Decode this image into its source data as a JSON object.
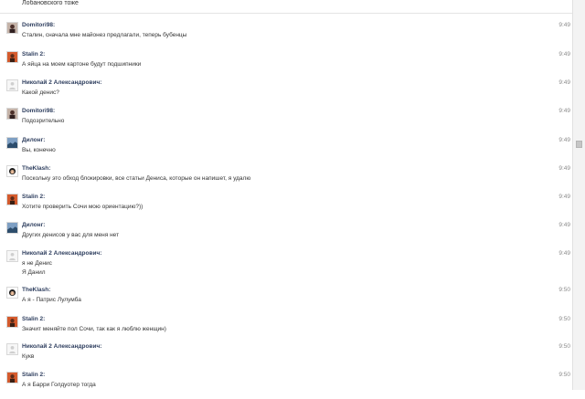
{
  "top_text": "Лобановского тоже",
  "messages": [
    {
      "author": "Domitori98:",
      "lines": [
        "Сталин, сначала мне майонез предлагали, теперь бубенцы"
      ],
      "time": "9:49",
      "avatar": "dark-portrait"
    },
    {
      "author": "Stalin 2:",
      "lines": [
        "А яйца на моем картоне будут подшипники"
      ],
      "time": "9:49",
      "avatar": "red-portrait"
    },
    {
      "author": "Николай 2 Александрович:",
      "lines": [
        "Какой денис?"
      ],
      "time": "9:49",
      "avatar": "default-user"
    },
    {
      "author": "Domitori98:",
      "lines": [
        "Подозрительно"
      ],
      "time": "9:49",
      "avatar": "dark-portrait"
    },
    {
      "author": "Дилонг:",
      "lines": [
        "Вы, конечно"
      ],
      "time": "9:49",
      "avatar": "blue-landscape"
    },
    {
      "author": "TheKlash:",
      "lines": [
        "Поскольку это обход блокировки, все статьи Дениса, которые он напишет, я удалю"
      ],
      "time": "9:49",
      "avatar": "cartoon-face"
    },
    {
      "author": "Stalin 2:",
      "lines": [
        "Хотите проверить Сочи мою ориентацию?))"
      ],
      "time": "9:49",
      "avatar": "red-portrait"
    },
    {
      "author": "Дилонг:",
      "lines": [
        "Других денисов у вас для меня нет"
      ],
      "time": "9:49",
      "avatar": "blue-landscape"
    },
    {
      "author": "Николай 2 Александрович:",
      "lines": [
        "я не Денис",
        "Я Данил"
      ],
      "time": "9:49",
      "avatar": "default-user"
    },
    {
      "author": "TheKlash:",
      "lines": [
        "А я - Патрис Лулумба"
      ],
      "time": "9:50",
      "avatar": "cartoon-face"
    },
    {
      "author": "Stalin 2:",
      "lines": [
        "Значит меняйте пол Сочи, так как я люблю женщин)"
      ],
      "time": "9:50",
      "avatar": "red-portrait"
    },
    {
      "author": "Николай 2 Александрович:",
      "lines": [
        "Кукв"
      ],
      "time": "9:50",
      "avatar": "default-user"
    },
    {
      "author": "Stalin 2:",
      "lines": [
        "А я Барри Голдуотер тогда"
      ],
      "time": "9:50",
      "avatar": "red-portrait"
    }
  ]
}
